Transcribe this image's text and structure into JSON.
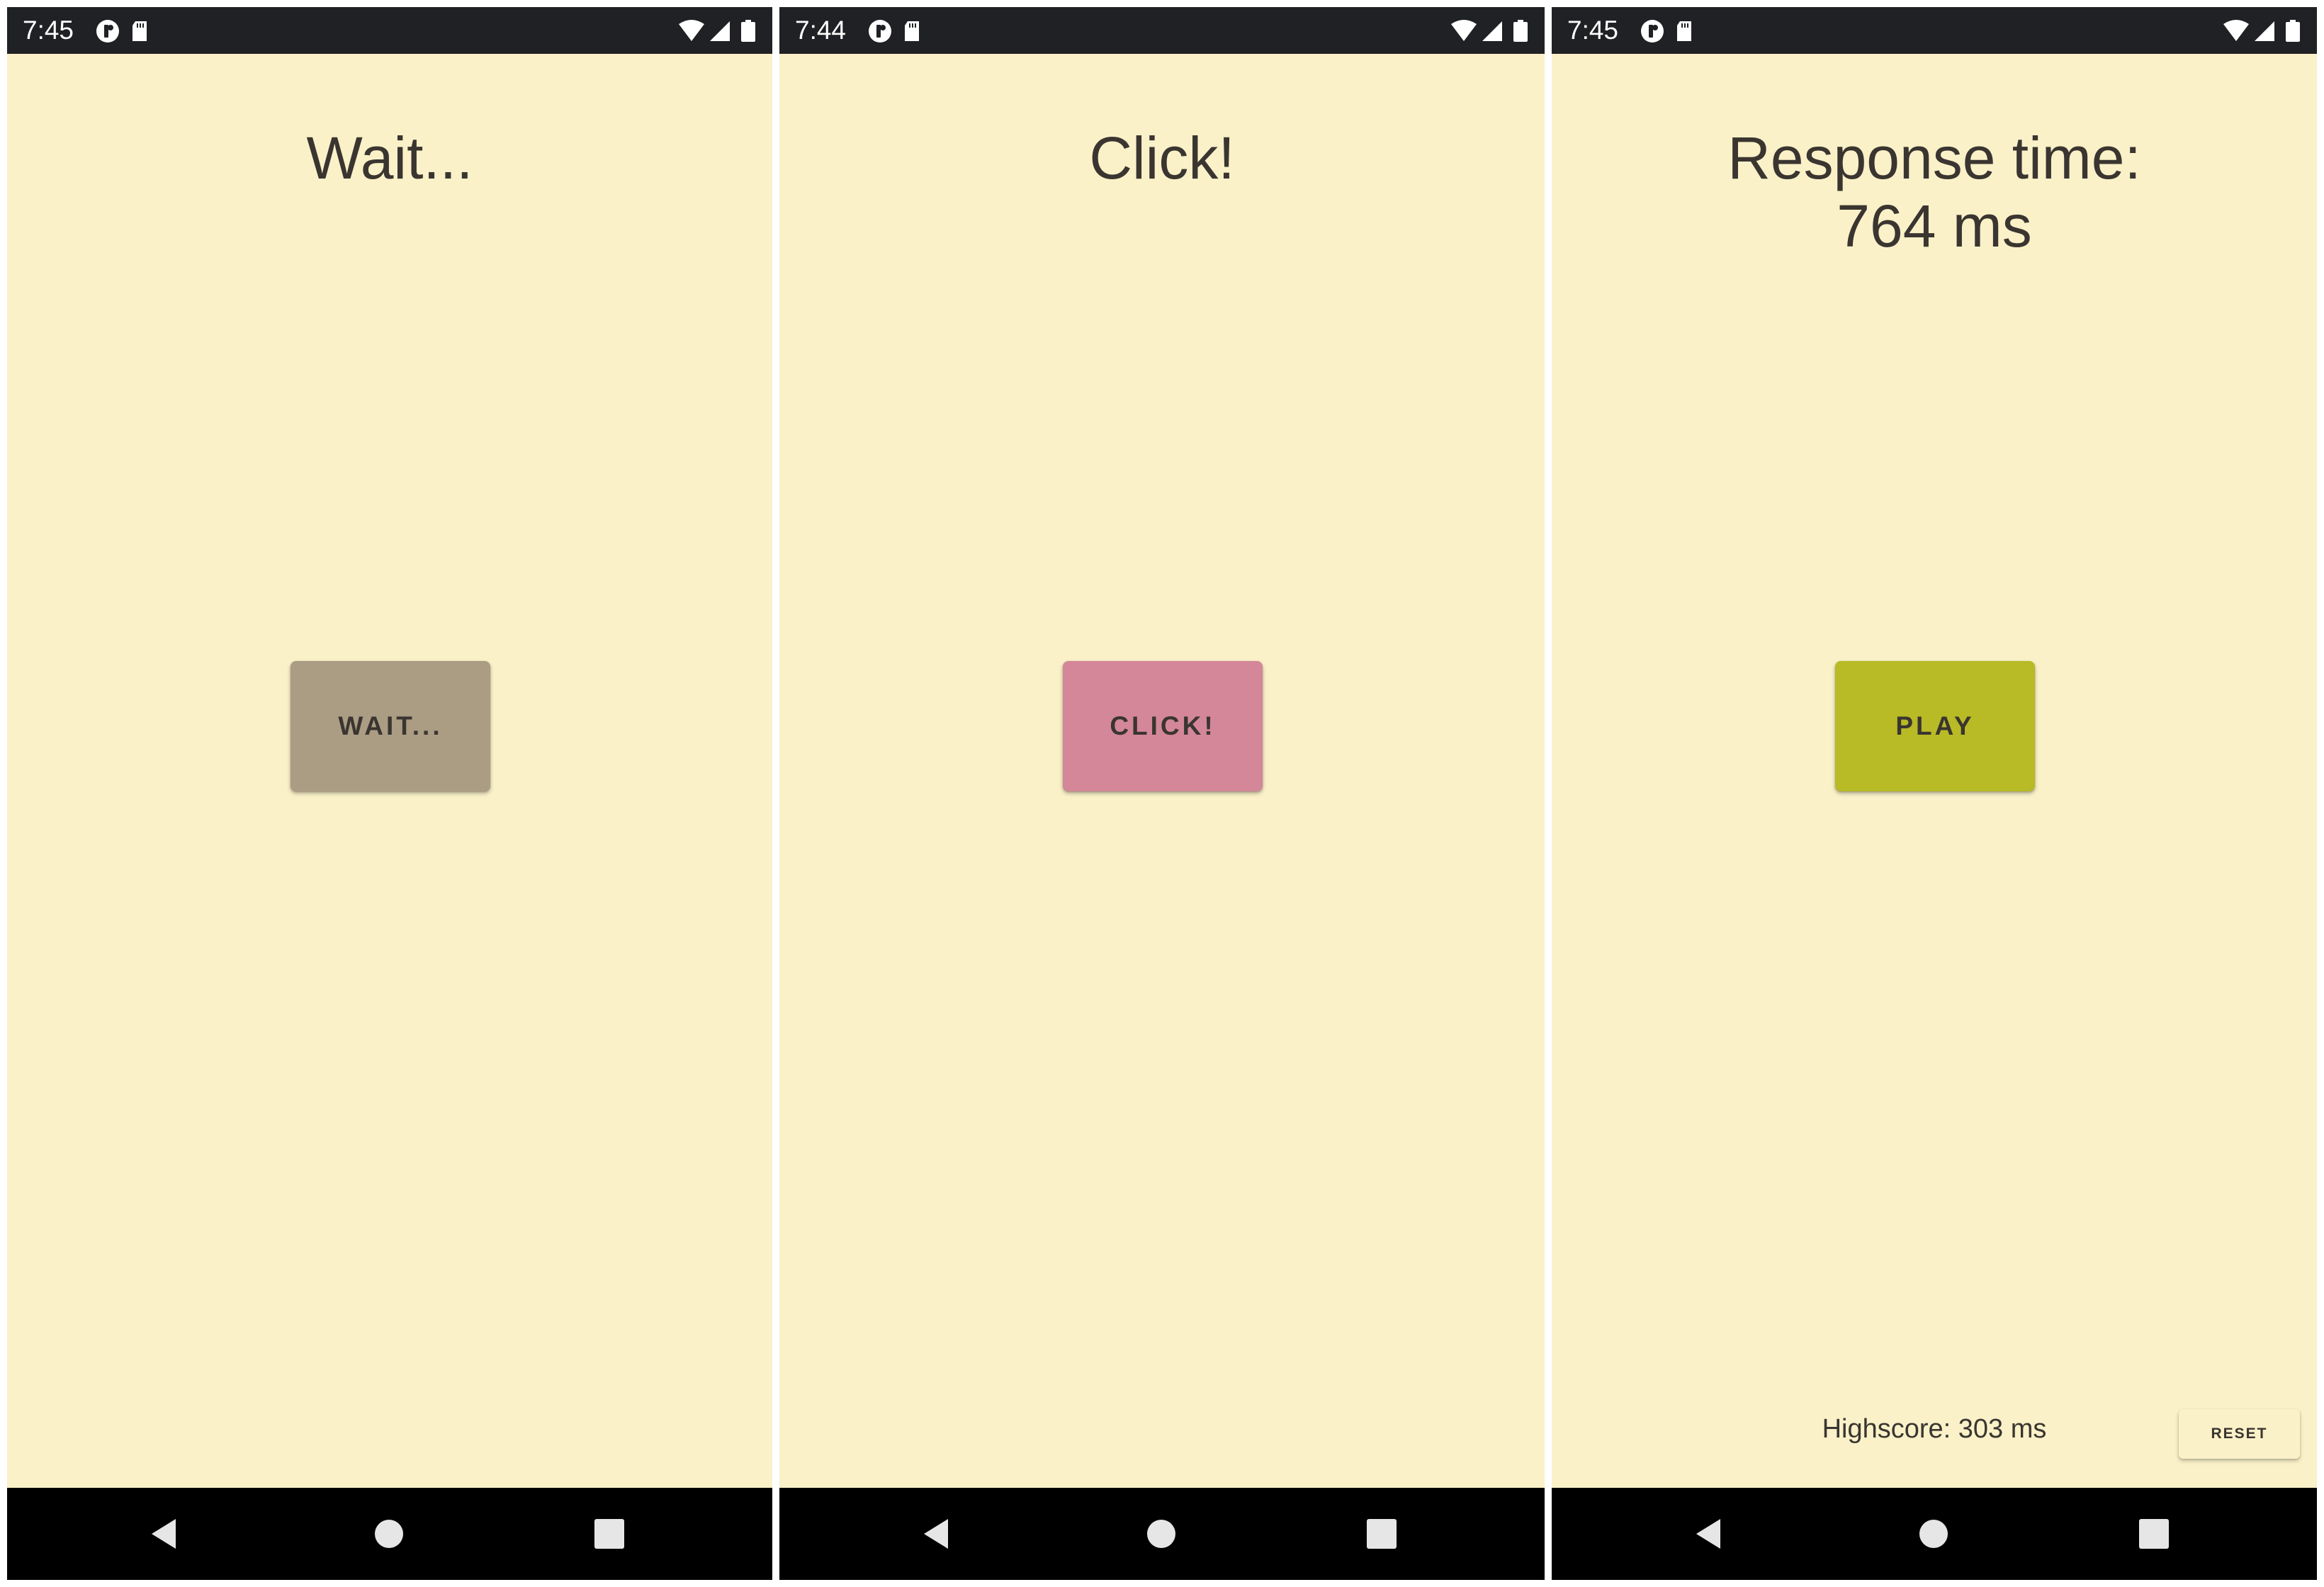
{
  "screens": [
    {
      "status_time": "7:45",
      "title_lines": [
        "Wait..."
      ],
      "button_label": "WAIT...",
      "button_color": "#AB9C84"
    },
    {
      "status_time": "7:44",
      "title_lines": [
        "Click!"
      ],
      "button_label": "CLICK!",
      "button_color": "#D48798"
    },
    {
      "status_time": "7:45",
      "title_lines": [
        "Response time:",
        "764 ms"
      ],
      "button_label": "PLAY",
      "button_color": "#B8BA26",
      "highscore_text": "Highscore: 303 ms",
      "reset_label": "RESET"
    }
  ],
  "status_icons": {
    "left": [
      "circle-c-icon",
      "sd-card-icon"
    ],
    "right": [
      "wifi-icon",
      "cell-signal-icon",
      "battery-icon"
    ]
  },
  "nav_icons": [
    "back-icon",
    "home-icon",
    "recents-icon"
  ],
  "colors": {
    "background": "#FAF1C8",
    "status_bar": "#202124",
    "nav_bar": "#000000",
    "text": "#3A3530"
  }
}
